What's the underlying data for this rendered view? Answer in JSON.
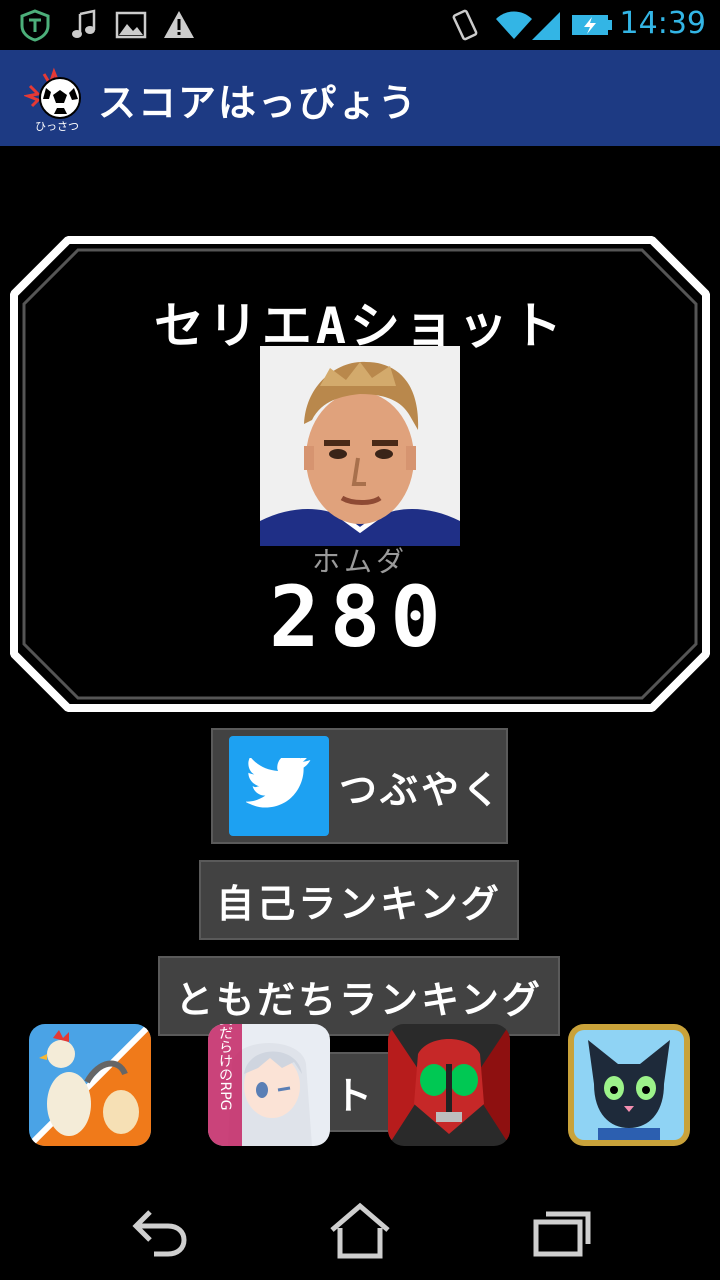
{
  "status_bar": {
    "time": "14:39",
    "icons": [
      "vpn-shield-icon",
      "music-note-icon",
      "image-icon",
      "warning-icon",
      "vibrate-icon",
      "wifi-icon",
      "signal-icon",
      "battery-charging-icon"
    ]
  },
  "action_bar": {
    "title": "スコアはっぴょう",
    "logo_caption": "ひっさつ"
  },
  "score": {
    "title": "セリエAショット",
    "player_name": "ホムダ",
    "value": "280"
  },
  "buttons": {
    "tweet": "つぶやく",
    "self_ranking": "自己ランキング",
    "friend_ranking": "ともだちランキング",
    "extra": "ト"
  },
  "ads": {
    "ad2_caption": "乙女だらけのRPG"
  },
  "colors": {
    "action_bar": "#1d3a83",
    "button_bg": "#424242",
    "twitter_blue": "#1da1f2",
    "time_blue": "#33b5e5"
  }
}
